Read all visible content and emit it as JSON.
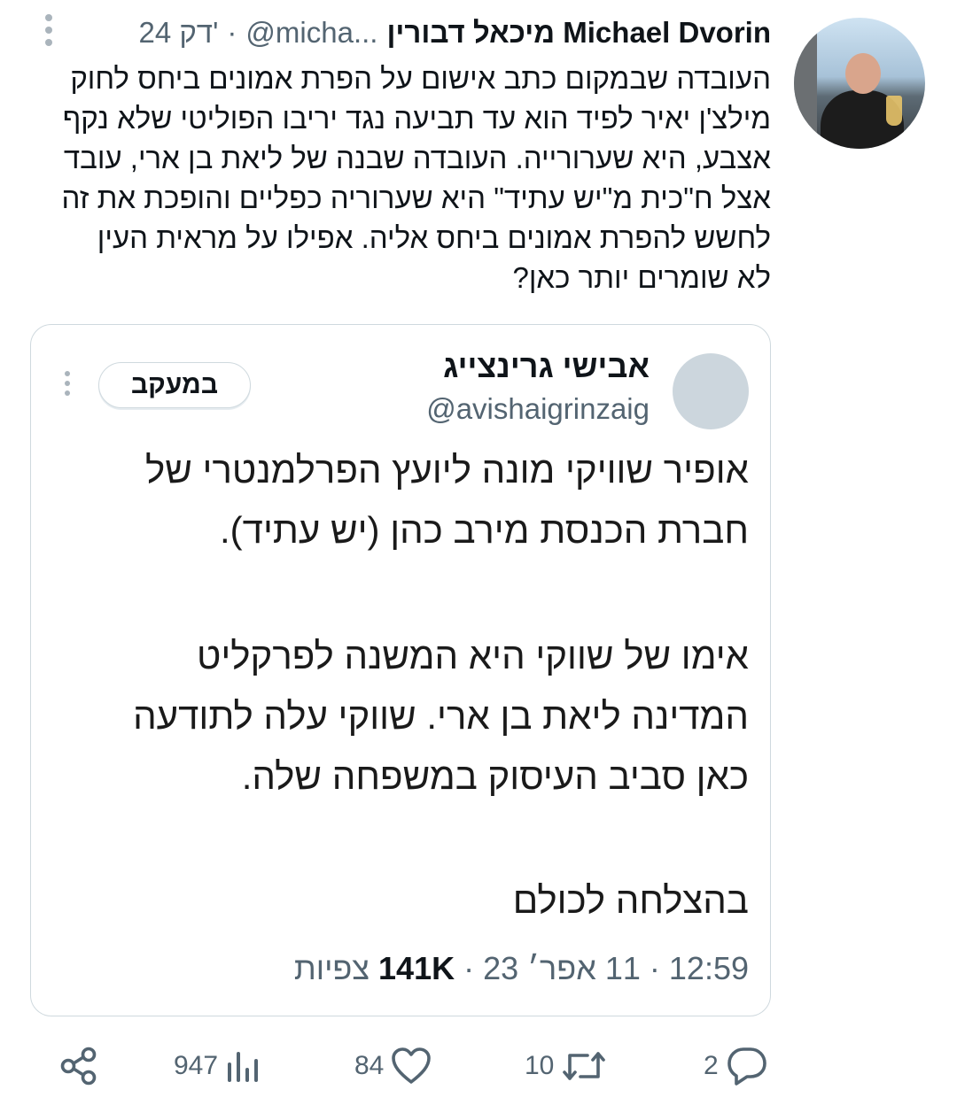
{
  "author": {
    "name": "מיכאל דבורין Michael Dvorin",
    "handle": "@micha...",
    "time": "24 דק'",
    "separator": "·"
  },
  "tweet_lines": [
    "העובדה שבמקום כתב אישום על הפרת אמונים ביחס לחוק",
    "מילצ'ן יאיר לפיד הוא עד תביעה נגד יריבו הפוליטי שלא נקף",
    "אצבע, היא שערורייה. העובדה שבנה של ליאת בן ארי, עובד",
    "אצל ח\"כית מ\"יש עתיד\" היא שערוריה כפליים והופכת את זה",
    "לחשש להפרת אמונים ביחס אליה. אפילו על מראית העין",
    "לא שומרים יותר כאן?"
  ],
  "quote": {
    "name": "אבישי גרינצייג",
    "handle": "@avishaigrinzaig",
    "follow_label": "במעקב",
    "paragraphs": [
      [
        "אופיר שוויקי מונה ליועץ הפרלמנטרי של",
        "חברת הכנסת מירב כהן (יש עתיד)."
      ],
      [
        "אימו של שווקי היא המשנה לפרקליט",
        "המדינה ליאת בן ארי. שווקי עלה לתודעה",
        "כאן סביב העיסוק במשפחה שלה."
      ],
      [
        "בהצלחה לכולם"
      ]
    ],
    "meta": {
      "time": "12:59",
      "date": "11 אפר׳ 23",
      "views_count": "141K",
      "views_label": "צפיות",
      "separator": "·"
    }
  },
  "actions": {
    "replies": "2",
    "retweets": "10",
    "likes": "84",
    "views": "947"
  },
  "colors": {
    "text": "#0f1419",
    "secondary": "#536471",
    "border": "#cfd9de",
    "icon": "#536471"
  },
  "icons": [
    "more-icon",
    "reply-icon",
    "retweet-icon",
    "like-icon",
    "views-icon",
    "share-icon"
  ]
}
